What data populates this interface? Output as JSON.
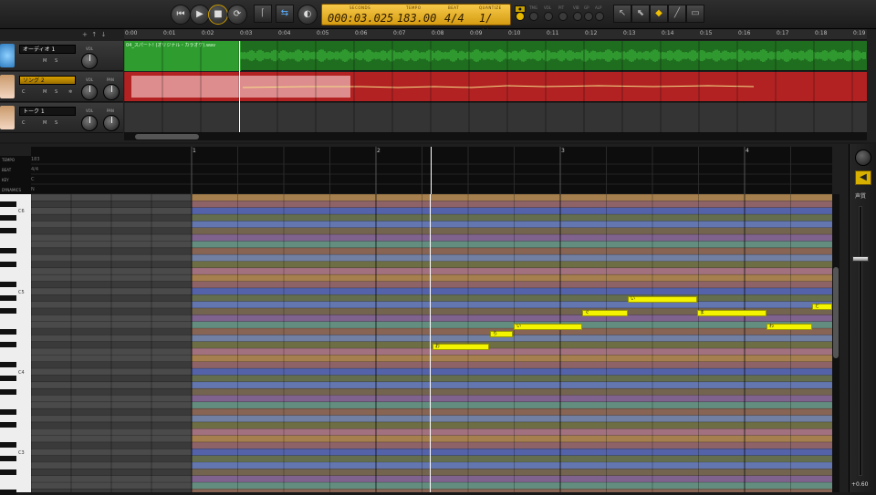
{
  "transport": {
    "lcd": {
      "seconds_label": "SECONDS",
      "seconds": "000:03.025",
      "tempo_label": "TEMPO",
      "tempo": "183.00",
      "beat_label": "BEAT",
      "beat": "4/4",
      "quantize_label": "QUANTIZE",
      "quantize": "1/ 16"
    },
    "mini_labels": [
      "TMG",
      "VOL",
      "PIT",
      "VIB",
      "GP",
      "ALP"
    ]
  },
  "ruler": {
    "ticks": [
      "0:00",
      "0:01",
      "0:02",
      "0:03",
      "0:04",
      "0:05",
      "0:06",
      "0:07",
      "0:08",
      "0:09",
      "0:10",
      "0:11",
      "0:12",
      "0:13",
      "0:14",
      "0:15",
      "0:16",
      "0:17",
      "0:18",
      "0:19"
    ]
  },
  "tracks": [
    {
      "name": "オーディオ 1",
      "buttons": [
        "M",
        "S"
      ],
      "knob_labels": [
        "VOL"
      ],
      "clip_title": "04_スパート! (オリジナル・カラオケ).wav",
      "color": "#2e8c2e",
      "avatar": "circle-avatar-icon"
    },
    {
      "name": "ソング 2",
      "buttons": [
        "C",
        "M",
        "S"
      ],
      "knob_labels": [
        "VOL",
        "PAN"
      ],
      "color": "#c02a2a",
      "avatar": "girl-avatar-icon"
    },
    {
      "name": "トーク 1",
      "buttons": [
        "C",
        "M",
        "S"
      ],
      "knob_labels": [
        "VOL",
        "PAN"
      ],
      "color": "#3a3a3a",
      "avatar": "girl-avatar-icon"
    }
  ],
  "roll_header": {
    "rows": [
      {
        "label": "TEMPO",
        "value": "183"
      },
      {
        "label": "BEAT",
        "value": "4/4"
      },
      {
        "label": "KEY",
        "value": "C"
      },
      {
        "label": "DYNAMICS",
        "value": "N"
      }
    ],
    "measures": [
      "1",
      "2",
      "3",
      "4"
    ]
  },
  "keyboard": {
    "octave_labels": [
      "C6",
      "C5",
      "C4",
      "C3"
    ]
  },
  "notes": [
    {
      "lyric": "お"
    },
    {
      "lyric": "ら"
    },
    {
      "lyric": "い"
    },
    {
      "lyric": "ぐ"
    },
    {
      "lyric": "い"
    },
    {
      "lyric": "ま"
    },
    {
      "lyric": "わ"
    },
    {
      "lyric": "ど"
    }
  ],
  "mixer": {
    "label": "声質",
    "level": "+0.60"
  },
  "colors": {
    "accent": "#f4c23a",
    "note": "#f4f400",
    "audio_lane": "#2e8c2e",
    "song_lane": "#c02a2a"
  }
}
